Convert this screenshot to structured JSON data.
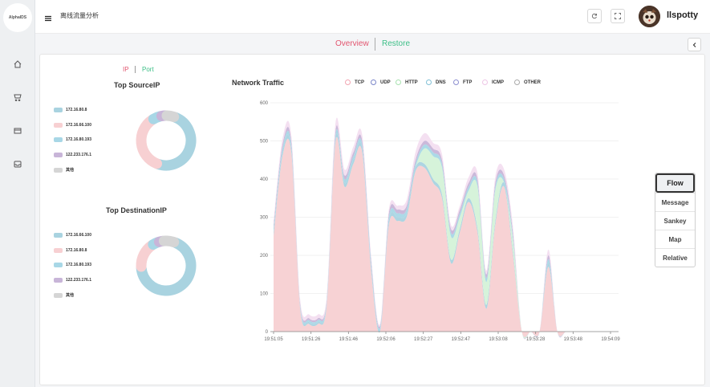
{
  "rail": {
    "logo_text": "AlphaIDS",
    "items": [
      {
        "icon": "home-icon"
      },
      {
        "icon": "cart-icon"
      },
      {
        "icon": "box-icon"
      },
      {
        "icon": "inbox-icon"
      }
    ]
  },
  "topbar": {
    "page_title": "离线流量分析",
    "refresh_icon": "refresh-icon",
    "fullscreen_icon": "fullscreen-icon",
    "username": "llspotty"
  },
  "tabs": {
    "overview": "Overview",
    "restore": "Restore",
    "overview_color": "#e2556f",
    "restore_color": "#3dbf87"
  },
  "left_panel": {
    "toggle_ip": "IP",
    "toggle_port": "Port",
    "source": {
      "title": "Top SourceIP",
      "items": [
        {
          "label": "172.16.80.8",
          "value": 45,
          "color": "#a9d3e0"
        },
        {
          "label": "172.16.66.100",
          "value": 32,
          "color": "#f7d0d2"
        },
        {
          "label": "172.16.80.193",
          "value": 5,
          "color": "#a8d7e6"
        },
        {
          "label": "122.233.176.1",
          "value": 3,
          "color": "#c8b5d8"
        },
        {
          "label": "其他",
          "value": 5,
          "color": "#d5d5d5"
        }
      ]
    },
    "destination": {
      "title": "Top DestinationIP",
      "items": [
        {
          "label": "172.16.66.100",
          "value": 65,
          "color": "#a9d3e0"
        },
        {
          "label": "172.16.80.8",
          "value": 16,
          "color": "#f7d0d2"
        },
        {
          "label": "172.16.80.193",
          "value": 4,
          "color": "#a8d7e6"
        },
        {
          "label": "122.233.176.1",
          "value": 3,
          "color": "#c8b5d8"
        },
        {
          "label": "其他",
          "value": 7,
          "color": "#d5d5d5"
        }
      ]
    }
  },
  "chart_data": {
    "type": "area",
    "title": "Network Traffic",
    "stacked": true,
    "ylim": [
      0,
      600
    ],
    "yticks": [
      0,
      100,
      200,
      300,
      400,
      500,
      600
    ],
    "grid": true,
    "legend_position": "top",
    "xticks": [
      "19:51:05",
      "19:51:26",
      "19:51:46",
      "19:52:06",
      "19:52:27",
      "19:52:47",
      "19:53:08",
      "19:53:28",
      "19:53:48",
      "19:54:09"
    ],
    "x": [
      "19:51:05",
      "19:51:10",
      "19:51:15",
      "19:51:21",
      "19:51:26",
      "19:51:31",
      "19:51:36",
      "19:51:41",
      "19:51:46",
      "19:51:51",
      "19:51:56",
      "19:52:01",
      "19:52:06",
      "19:52:11",
      "19:52:16",
      "19:52:22",
      "19:52:27",
      "19:52:32",
      "19:52:37",
      "19:52:42",
      "19:52:47",
      "19:52:52",
      "19:52:57",
      "19:53:03",
      "19:53:08",
      "19:53:13",
      "19:53:18",
      "19:53:23",
      "19:53:28",
      "19:53:33",
      "19:53:38",
      "19:53:43",
      "19:53:48",
      "19:53:53",
      "19:53:58",
      "19:54:04",
      "19:54:09",
      "19:54:14",
      "19:54:19"
    ],
    "series": [
      {
        "name": "TCP",
        "color": "#f7d0d2",
        "values": [
          250,
          460,
          470,
          60,
          20,
          20,
          70,
          500,
          380,
          440,
          470,
          160,
          0,
          280,
          290,
          300,
          420,
          430,
          390,
          350,
          180,
          260,
          340,
          260,
          60,
          280,
          380,
          200,
          0,
          0,
          0,
          170,
          0,
          0,
          0,
          0,
          0,
          0,
          0
        ]
      },
      {
        "name": "UDP",
        "color": "#a9d3e0",
        "values": [
          10,
          10,
          10,
          5,
          5,
          5,
          5,
          10,
          10,
          10,
          10,
          10,
          5,
          10,
          10,
          10,
          10,
          10,
          10,
          10,
          10,
          10,
          10,
          10,
          10,
          10,
          10,
          10,
          0,
          0,
          0,
          10,
          0,
          0,
          0,
          0,
          0,
          0,
          0
        ]
      },
      {
        "name": "HTTP",
        "color": "#d4f2d8",
        "values": [
          0,
          0,
          0,
          0,
          0,
          0,
          0,
          0,
          0,
          0,
          0,
          0,
          0,
          0,
          0,
          0,
          0,
          40,
          60,
          70,
          60,
          30,
          20,
          110,
          60,
          80,
          0,
          30,
          0,
          0,
          0,
          0,
          0,
          0,
          0,
          0,
          0,
          0,
          0
        ]
      },
      {
        "name": "DNS",
        "color": "#a8d7e6",
        "values": [
          10,
          10,
          10,
          5,
          5,
          5,
          5,
          10,
          10,
          10,
          10,
          10,
          5,
          10,
          10,
          10,
          10,
          10,
          10,
          10,
          10,
          10,
          10,
          10,
          10,
          10,
          10,
          10,
          0,
          0,
          0,
          10,
          0,
          0,
          0,
          0,
          0,
          0,
          0
        ]
      },
      {
        "name": "FTP",
        "color": "#c8b5d8",
        "values": [
          10,
          10,
          10,
          5,
          5,
          5,
          5,
          10,
          10,
          10,
          10,
          10,
          5,
          10,
          10,
          10,
          10,
          10,
          10,
          10,
          10,
          10,
          10,
          10,
          10,
          10,
          10,
          10,
          0,
          0,
          0,
          10,
          0,
          0,
          0,
          0,
          0,
          0,
          0
        ]
      },
      {
        "name": "ICMP",
        "color": "#f3def0",
        "values": [
          10,
          15,
          15,
          10,
          10,
          10,
          10,
          20,
          15,
          15,
          15,
          10,
          5,
          10,
          10,
          15,
          20,
          20,
          15,
          15,
          10,
          10,
          15,
          15,
          10,
          15,
          15,
          15,
          0,
          0,
          0,
          15,
          0,
          0,
          0,
          0,
          0,
          0,
          0
        ]
      },
      {
        "name": "OTHER",
        "color": "#d5d5d5",
        "values": [
          0,
          0,
          0,
          0,
          0,
          0,
          0,
          0,
          0,
          0,
          0,
          0,
          0,
          0,
          0,
          0,
          0,
          0,
          0,
          0,
          0,
          0,
          0,
          0,
          0,
          0,
          0,
          0,
          0,
          0,
          0,
          0,
          0,
          0,
          0,
          0,
          0,
          0,
          0
        ]
      }
    ]
  },
  "side_menu": {
    "items": [
      "Flow",
      "Message",
      "Sankey",
      "Map",
      "Relative"
    ],
    "active": "Flow"
  }
}
